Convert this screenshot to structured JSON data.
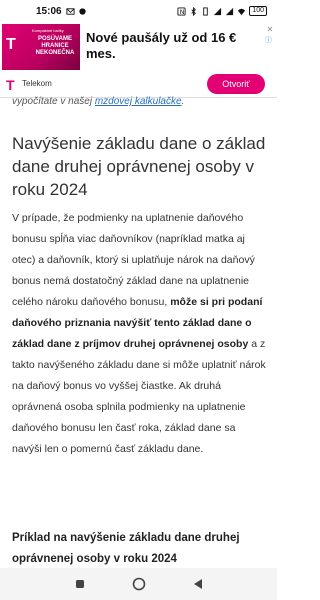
{
  "status_bar": {
    "time": "15:06",
    "battery": "100",
    "icons": [
      "mail-icon",
      "message-icon",
      "notification-icon",
      "bluetooth-icon",
      "vibrate-icon",
      "signal-icon",
      "signal-icon-2",
      "wifi-icon",
      "battery-icon"
    ]
  },
  "ad": {
    "image_tag": "Kompaktné balíky",
    "image_text": "POSÚVAME HRANICE NEKONEČNA",
    "logo_letter": "T",
    "title": "Nové paušály už od 16 € mes.",
    "brand": "Telekom",
    "cta": "Otvoriť",
    "close_symbol": "✕",
    "info_symbol": "ⓘ",
    "accent_color": "#e20074"
  },
  "article": {
    "partial_prefix": "vypočítate v našej ",
    "partial_link": "mzdovej kalkulačke",
    "partial_suffix": ".",
    "heading": "Navýšenie základu dane o základ dane druhej oprávnenej osoby v roku 2024",
    "para_1": "V prípade, že podmienky na uplatnenie daňového bonusu spĺňa viac daňovníkov (napríklad matka aj otec) a daňovník, ktorý si uplatňuje nárok na daňový bonus nemá dostatočný základ dane na uplatnenie celého nároku daňového bonusu, ",
    "para_bold": "môže si pri podaní daňového priznania navýšiť tento základ dane o základ dane z príjmov druhej oprávnenej osoby",
    "para_2": " a z takto navýšeného základu dane si môže uplatniť nárok na daňový bonus vo vyššej čiastke. Ak druhá oprávnená osoba splnila podmienky na uplatnenie daňového bonusu len časť roka, základ dane sa navýši len o pomernú časť základu dane.",
    "subheading": "Príklad na navýšenie základu dane druhej oprávnenej osoby v roku 2024"
  },
  "nav": {
    "recents_icon": "recents-icon",
    "home_icon": "home-icon",
    "back_icon": "back-icon"
  }
}
